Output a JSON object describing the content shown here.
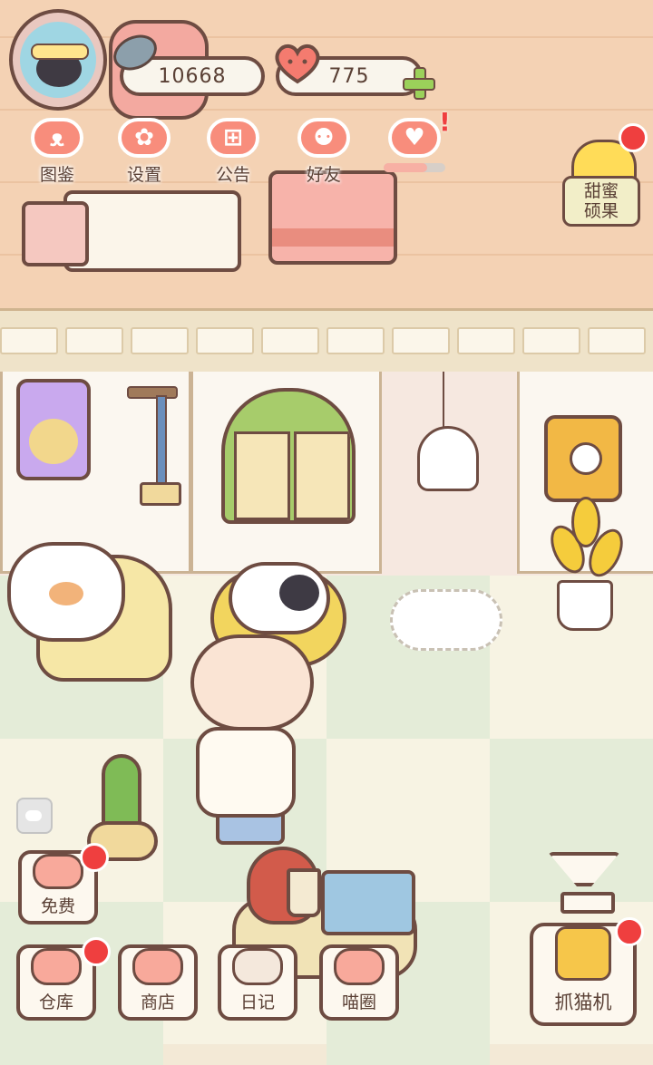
{
  "hud": {
    "coins": "10668",
    "hearts": "775"
  },
  "top_menu": [
    {
      "label": "图鉴",
      "icon": "cat-head-icon"
    },
    {
      "label": "设置",
      "icon": "gear-icon"
    },
    {
      "label": "公告",
      "icon": "gift-icon"
    },
    {
      "label": "好友",
      "icon": "friends-icon"
    },
    {
      "label": "",
      "icon": "heart-gift-icon"
    }
  ],
  "event_button": {
    "line1": "甜蜜",
    "line2": "硕果"
  },
  "side_buttons": {
    "free": "免费"
  },
  "bottom_bar": [
    {
      "label": "仓库",
      "icon": "warehouse-icon"
    },
    {
      "label": "商店",
      "icon": "shop-icon"
    },
    {
      "label": "日记",
      "icon": "diary-icon"
    },
    {
      "label": "喵圈",
      "icon": "cat-planet-icon"
    }
  ],
  "claw_machine": {
    "label": "抓猫机"
  },
  "colors": {
    "accent": "#f88d7c",
    "outline": "#6e4c42",
    "notify": "#ef3f3f",
    "plus": "#9bd15a"
  }
}
